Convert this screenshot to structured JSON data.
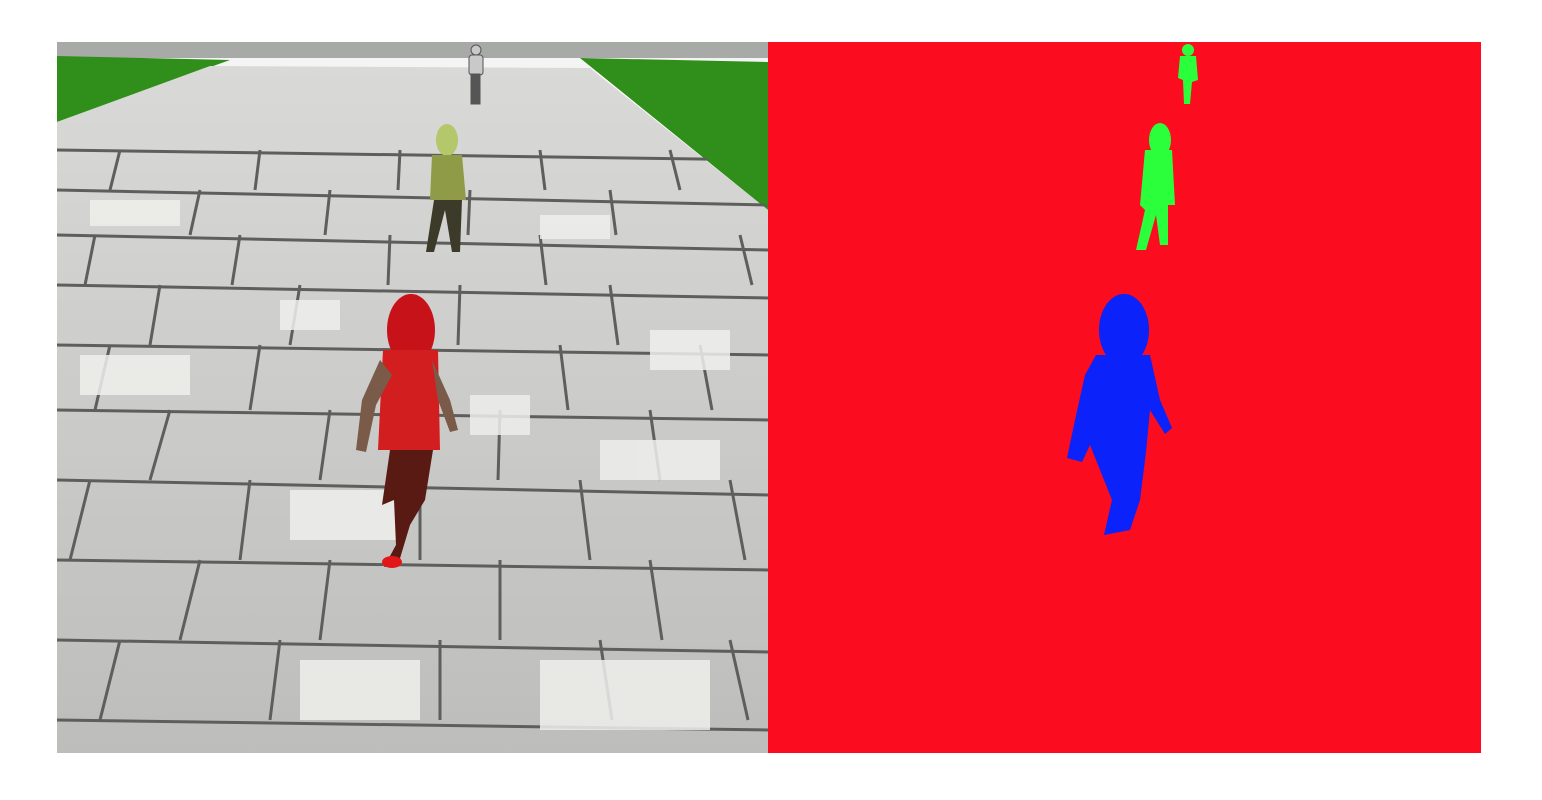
{
  "figure": {
    "panels": [
      {
        "id": "rgb-render",
        "kind": "rendered-scene",
        "figures": [
          {
            "name": "far-pedestrian",
            "color": "#c8c8c8"
          },
          {
            "name": "middle-pedestrian",
            "color": "#9aa84a"
          },
          {
            "name": "near-pedestrian",
            "color": "#d21e1e"
          }
        ],
        "ground": "stone-pavement",
        "sky_color": "#f4f4f4",
        "grass_color": "#2f8f1a"
      },
      {
        "id": "segmentation-mask",
        "kind": "segmentation",
        "background_color": "#fb0c1e",
        "masks": [
          {
            "name": "far-pedestrian-mask",
            "color": "#2bff3c"
          },
          {
            "name": "middle-pedestrian-mask",
            "color": "#2bff3c"
          },
          {
            "name": "near-pedestrian-mask",
            "color": "#0b22fb"
          }
        ]
      }
    ]
  }
}
